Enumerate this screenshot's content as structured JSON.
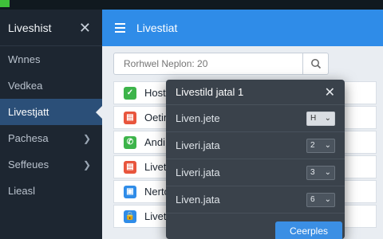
{
  "sidebar": {
    "title": "Liveshist",
    "items": [
      {
        "label": "Wnnes",
        "chevron": false,
        "active": false
      },
      {
        "label": "Vedkea",
        "chevron": false,
        "active": false
      },
      {
        "label": "Livestjatt",
        "chevron": true,
        "active": true
      },
      {
        "label": "Pachesa",
        "chevron": true,
        "active": false
      },
      {
        "label": "Seffeues",
        "chevron": true,
        "active": false
      },
      {
        "label": "Lieasl",
        "chevron": false,
        "active": false
      }
    ]
  },
  "header": {
    "title": "Livestiat"
  },
  "search": {
    "placeholder": "Rorhwel Neplon: 20"
  },
  "list": [
    {
      "label": "Host",
      "icon": "green-square-icon",
      "color": "#3db44a"
    },
    {
      "label": "Oetin",
      "icon": "red-square-icon",
      "color": "#e8553d"
    },
    {
      "label": "Andi",
      "icon": "phone-icon",
      "color": "#3db44a"
    },
    {
      "label": "Livet",
      "icon": "red-square-icon",
      "color": "#e8553d"
    },
    {
      "label": "Nerto",
      "icon": "blue-square-icon",
      "color": "#2f8ce8"
    },
    {
      "label": "Livetdjete",
      "icon": "lock-icon",
      "color": "#2f8ce8"
    }
  ],
  "dialog": {
    "title": "Livestild jatal 1",
    "rows": [
      {
        "label": "Liven.jete",
        "value": "H"
      },
      {
        "label": "Liveri.jata",
        "value": "2"
      },
      {
        "label": "Liveri.jata",
        "value": "3"
      },
      {
        "label": "Liven.jata",
        "value": "6"
      }
    ],
    "button": "Ceerples"
  },
  "colors": {
    "accent": "#2f8ce8",
    "sidebar": "#1d2631",
    "active": "#2b4f78",
    "dialog": "#3a424b"
  }
}
